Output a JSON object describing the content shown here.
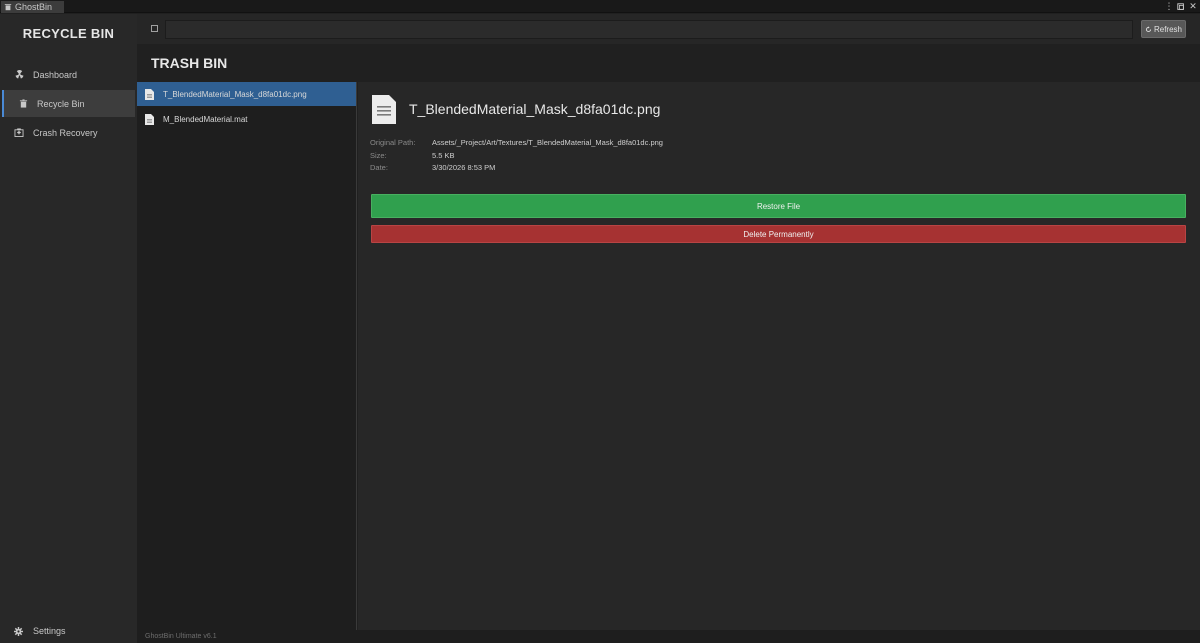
{
  "window": {
    "tab_title": "GhostBin",
    "tab_icon": "trash-icon",
    "controls": [
      "more-icon",
      "maximize-icon",
      "close-icon"
    ]
  },
  "sidebar": {
    "brand": "RECYCLE BIN",
    "items": [
      {
        "label": "Dashboard",
        "icon": "radiation-icon",
        "active": false
      },
      {
        "label": "Recycle Bin",
        "icon": "trash-icon",
        "active": true
      },
      {
        "label": "Crash Recovery",
        "icon": "hospital-icon",
        "active": false
      }
    ],
    "settings_label": "Settings",
    "version": "GhostBin Ultimate v6.1"
  },
  "toolbar": {
    "search_value": "",
    "refresh_label": "Refresh"
  },
  "page": {
    "title": "TRASH BIN"
  },
  "files": [
    {
      "name": "T_BlendedMaterial_Mask_d8fa01dc.png",
      "selected": true
    },
    {
      "name": "M_BlendedMaterial.mat",
      "selected": false
    }
  ],
  "detail": {
    "title": "T_BlendedMaterial_Mask_d8fa01dc.png",
    "fields": [
      {
        "label": "Original Path:",
        "value": "Assets/_Project/Art/Textures/T_BlendedMaterial_Mask_d8fa01dc.png"
      },
      {
        "label": "Size:",
        "value": "5.5 KB"
      },
      {
        "label": "Date:",
        "value": "3/30/2026 8:53 PM"
      }
    ],
    "restore_label": "Restore File",
    "delete_label": "Delete Permanently"
  },
  "colors": {
    "accent": "#2f5f92",
    "restore": "#30a04e",
    "delete": "#a63232"
  }
}
